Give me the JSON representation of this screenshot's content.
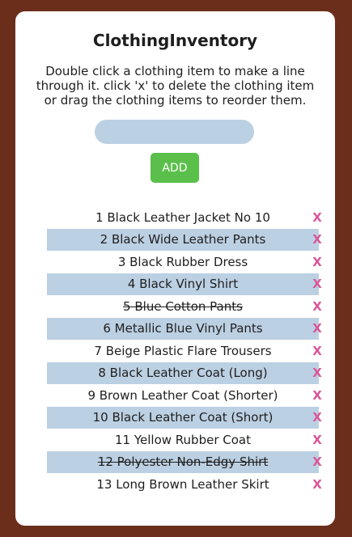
{
  "app": {
    "title": "ClothingInventory"
  },
  "instructions": "Double click a clothing item to make a line through it. click 'x' to delete the clothing item or drag the clothing items to reorder them.",
  "input": {
    "value": "",
    "placeholder": ""
  },
  "add_button": {
    "label": "ADD"
  },
  "delete_label": "X",
  "items": [
    {
      "label": "1 Black Leather Jacket No 10",
      "done": false
    },
    {
      "label": "2 Black Wide Leather Pants",
      "done": false
    },
    {
      "label": "3 Black Rubber Dress",
      "done": false
    },
    {
      "label": "4 Black Vinyl Shirt",
      "done": false
    },
    {
      "label": "5 Blue Cotton Pants",
      "done": true
    },
    {
      "label": "6 Metallic Blue Vinyl Pants",
      "done": false
    },
    {
      "label": "7 Beige Plastic Flare Trousers",
      "done": false
    },
    {
      "label": "8 Black Leather Coat (Long)",
      "done": false
    },
    {
      "label": "9 Brown Leather Coat (Shorter)",
      "done": false
    },
    {
      "label": "10 Black Leather Coat (Short)",
      "done": false
    },
    {
      "label": "11 Yellow Rubber Coat",
      "done": false
    },
    {
      "label": "12 Polyester Non-Edgy Shirt",
      "done": true
    },
    {
      "label": "13 Long Brown Leather Skirt",
      "done": false
    }
  ],
  "colors": {
    "background": "#6b2e1a",
    "card": "#ffffff",
    "input_fill": "#bcd0e3",
    "add_button": "#5bbf4b",
    "row_stripe": "#bcd0e3",
    "delete_x": "#d9569a"
  }
}
